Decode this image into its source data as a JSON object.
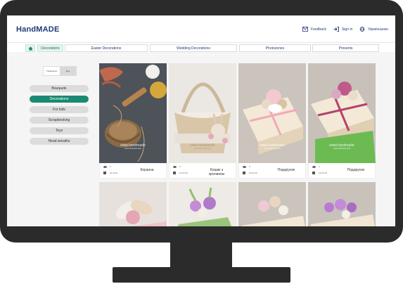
{
  "header": {
    "logo": "HandMADE",
    "links": [
      {
        "label": "Feedback",
        "icon": "mail-icon"
      },
      {
        "label": "Sign in",
        "icon": "sign-in-icon"
      },
      {
        "label": "Українською",
        "icon": "globe-icon"
      }
    ]
  },
  "nav": {
    "home_icon": "home-icon",
    "tabs": [
      {
        "label": "Decorations",
        "active": true
      },
      {
        "label": "Easter Decorations",
        "active": false
      },
      {
        "label": "Wedding Decorations",
        "active": false
      },
      {
        "label": "Photozones",
        "active": false
      },
      {
        "label": "Presents",
        "active": false
      }
    ]
  },
  "sidebar": {
    "toggle": [
      "Українська",
      "Eng"
    ],
    "filters": [
      {
        "label": "Bouquets",
        "active": false
      },
      {
        "label": "Decorations",
        "active": true
      },
      {
        "label": "For kids",
        "active": false
      },
      {
        "label": "Scrapbooking",
        "active": false
      },
      {
        "label": "Toys",
        "active": false
      },
      {
        "label": "Head wreaths",
        "active": false
      }
    ]
  },
  "cards": [
    {
      "views": "6",
      "date": "24.02.21",
      "title": "Корзина",
      "watermark": "www.handmade",
      "watermark_sub": "www.handmade.work"
    },
    {
      "views": "5",
      "date": "19.03.19",
      "title": "Кошик з кроликом",
      "watermark": "www.handmade",
      "watermark_sub": "www.handmade.work"
    },
    {
      "views": "0",
      "date": "19.03.19",
      "title": "Подарунок",
      "watermark": "www.handmade",
      "watermark_sub": "www.handmade.work"
    },
    {
      "views": "4",
      "date": "19.03.19",
      "title": "Подарунок",
      "watermark": "www.handmade",
      "watermark_sub": "www.handmade.work"
    }
  ],
  "colors": {
    "brand": "#1f3a73",
    "accent": "#1a8a73",
    "frame": "#2b2b2b"
  }
}
